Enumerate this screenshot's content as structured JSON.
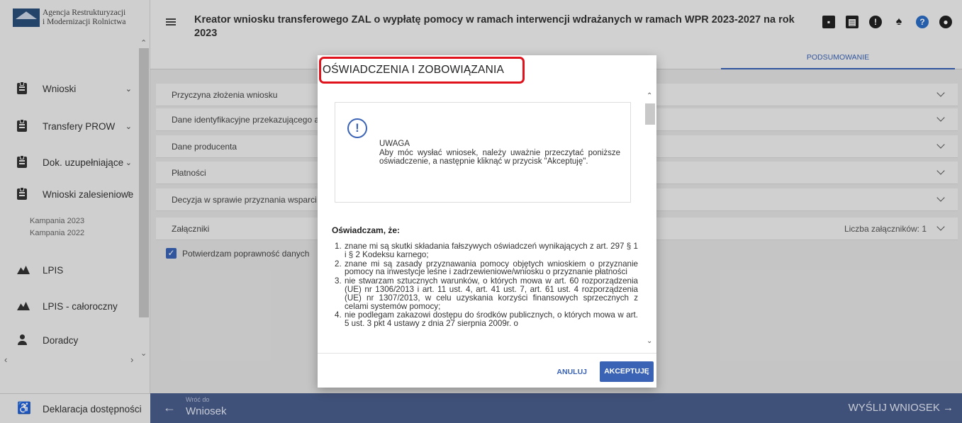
{
  "logo": {
    "line1": "Agencja Restrukturyzacji",
    "line2": "i Modernizacji Rolnictwa"
  },
  "sidebar": {
    "items": [
      {
        "label": "Wnioski",
        "chevron": "⌄"
      },
      {
        "label": "Transfery PROW",
        "chevron": "⌄"
      },
      {
        "label": "Dok. uzupełniające",
        "chevron": "⌄"
      },
      {
        "label": "Wnioski zalesieniowe",
        "chevron": "⌃"
      },
      {
        "label": "LPIS"
      },
      {
        "label": "LPIS - całoroczny"
      },
      {
        "label": "Doradcy"
      }
    ],
    "sub_items": [
      "Kampania 2023",
      "Kampania 2022"
    ],
    "footer_label": "Deklaracja dostępności"
  },
  "header": {
    "title": "Kreator wniosku transferowego ZAL o wypłatę pomocy w ramach interwencji wdrażanych w ramach WPR 2023-2027 na rok 2023",
    "icons": [
      "save-icon",
      "print-icon",
      "alert-icon",
      "bell-icon",
      "help-icon",
      "user-icon"
    ]
  },
  "tabs": {
    "summary": "PODSUMOWANIE"
  },
  "sections": [
    {
      "label": "Przyczyna złożenia wniosku"
    },
    {
      "label": "Dane identyfikacyjne przekazującego a"
    },
    {
      "label": "Dane producenta"
    },
    {
      "label": "Płatności"
    },
    {
      "label": "Decyzja w sprawie przyznania wsparci"
    },
    {
      "label": "Załączniki",
      "extra": "Liczba załączników: 1"
    }
  ],
  "confirm_label": "Potwierdzam poprawność danych",
  "bottom": {
    "back_small": "Wróć do",
    "back_label": "Wniosek",
    "send_label": "WYŚLIJ WNIOSEK →"
  },
  "modal": {
    "title": "OŚWIADCZENIA I ZOBOWIĄZANIA",
    "warning_head": "UWAGA",
    "warning_text": "Aby móc wysłać wniosek, należy uważnie przeczytać poniższe oświadczenie, a następnie kliknąć w przycisk \"Akceptuję\".",
    "declaration_head": "Oświadczam, że:",
    "declarations": [
      "znane mi są skutki składania fałszywych oświadczeń wynikających z art. 297 § 1 i § 2 Kodeksu karnego;",
      "znane mi są zasady przyznawania pomocy objętych wnioskiem o przyznanie pomocy na inwestycje leśne i zadrzewieniowe/wniosku o przyznanie płatności",
      "nie stwarzam sztucznych warunków, o których mowa w art. 60 rozporządzenia (UE) nr 1306/2013 i art. 11 ust. 4, art. 41 ust. 7, art. 61 ust. 4 rozporządzenia (UE) nr 1307/2013, w celu uzyskania korzyści finansowych sprzecznych z celami systemów pomocy;",
      "nie podlegam zakazowi dostępu do środków publicznych, o których mowa w art. 5 ust. 3 pkt 4 ustawy z dnia 27 sierpnia 2009r. o"
    ],
    "cancel_label": "ANULUJ",
    "accept_label": "AKCEPTUJĘ"
  },
  "colors": {
    "accent": "#3a63b5",
    "highlight": "#e0121c",
    "bottom_bar": "#4a5d8c"
  }
}
